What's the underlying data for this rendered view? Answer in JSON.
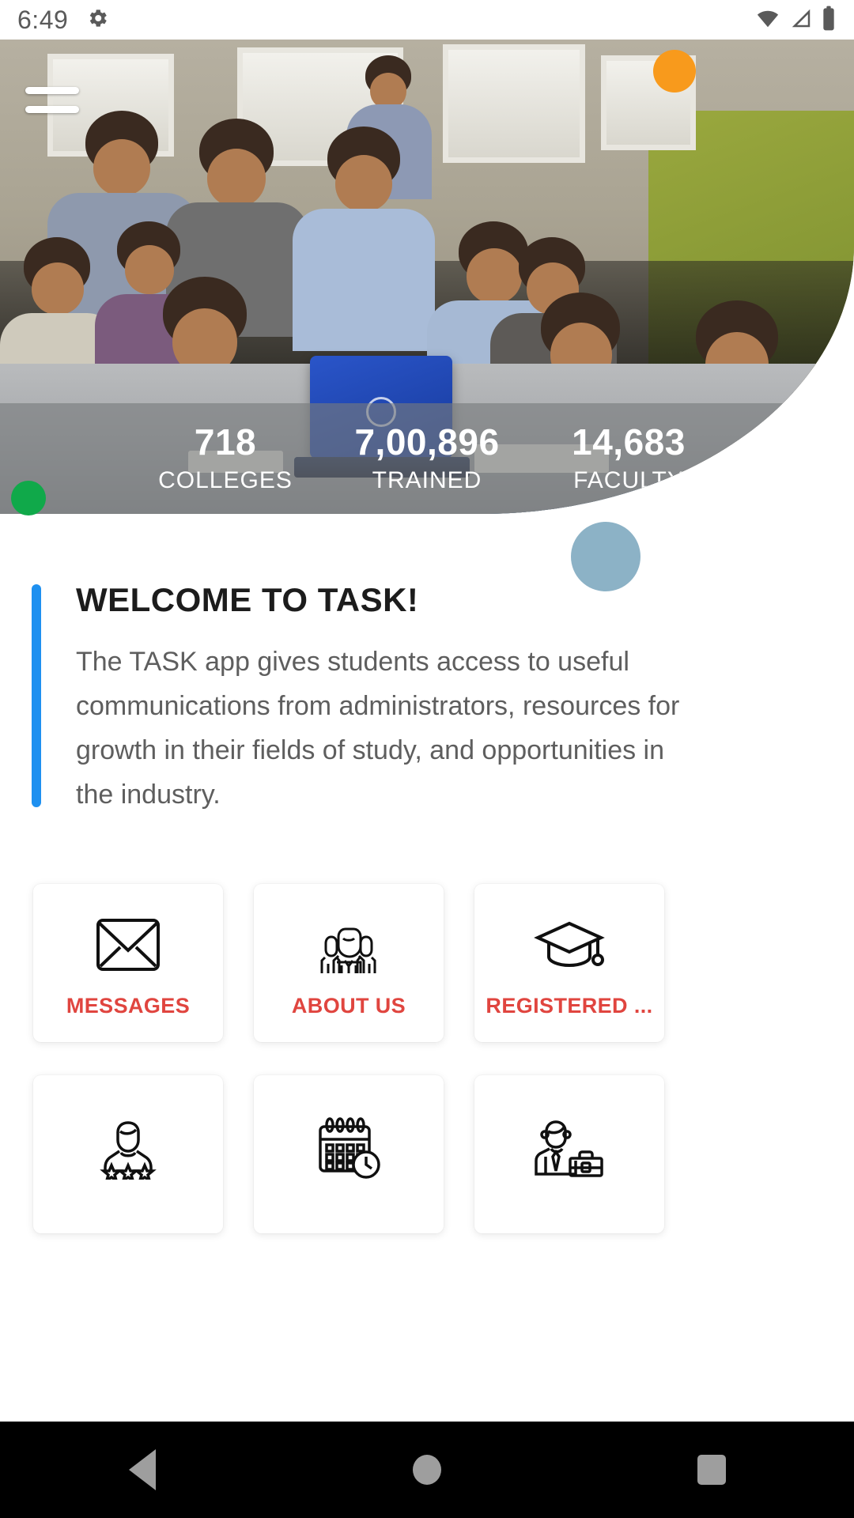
{
  "status_bar": {
    "time": "6:49",
    "gear_icon": "gear-icon",
    "wifi_icon": "wifi-icon",
    "signal_icon": "cellular-signal-icon",
    "battery_icon": "battery-icon"
  },
  "hero": {
    "menu_icon": "hamburger-menu-icon",
    "photo_alt": "students-working-on-laptops-classroom-photo",
    "stats": [
      {
        "value": "718",
        "label": "COLLEGES"
      },
      {
        "value": "7,00,896",
        "label": "TRAINED"
      },
      {
        "value": "14,683",
        "label": "FACULTY"
      }
    ],
    "decorations": [
      {
        "name": "orange-dot",
        "color": "#f89a1c"
      },
      {
        "name": "green-dot",
        "color": "#10a94a"
      },
      {
        "name": "blue-dot",
        "color": "#8cb2c6"
      }
    ]
  },
  "welcome": {
    "title": "WELCOME TO TASK!",
    "body": "The TASK app gives students access to useful communications from administrators, resources for growth in their fields of study, and opportunities in the industry.",
    "accent_color": "#1e90f0"
  },
  "menu": {
    "label_color": "#e0453f",
    "cards": [
      {
        "label": "MESSAGES",
        "icon": "envelope-icon"
      },
      {
        "label": "ABOUT US",
        "icon": "people-group-icon"
      },
      {
        "label": "REGISTERED ...",
        "icon": "graduation-cap-icon"
      },
      {
        "label": "",
        "icon": "person-with-stars-icon"
      },
      {
        "label": "",
        "icon": "calendar-clock-icon"
      },
      {
        "label": "",
        "icon": "businessman-briefcase-icon"
      }
    ]
  },
  "nav_bar": {
    "back_icon": "back-triangle-icon",
    "home_icon": "home-circle-icon",
    "recents_icon": "recents-square-icon"
  }
}
